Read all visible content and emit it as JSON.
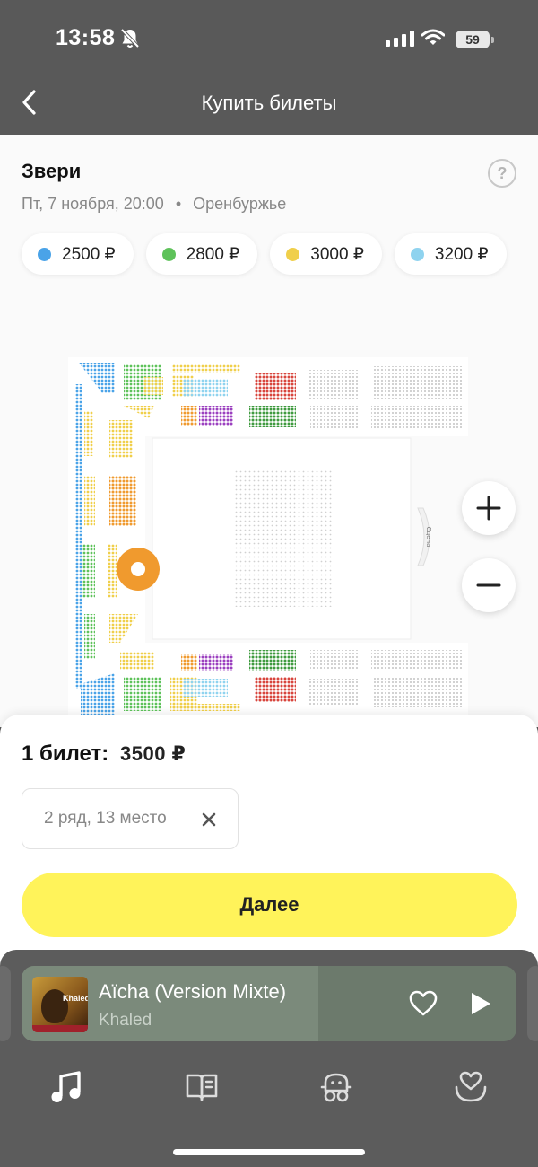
{
  "status_bar": {
    "time": "13:58",
    "battery": "59"
  },
  "nav": {
    "title": "Купить билеты"
  },
  "event": {
    "title": "Звери",
    "date": "Пт, 7 ноября, 20:00",
    "separator": "•",
    "venue": "Оренбуржье",
    "help_label": "?"
  },
  "prices": [
    {
      "label": "2500 ₽",
      "color": "#4aa3e8"
    },
    {
      "label": "2800 ₽",
      "color": "#5ec25a"
    },
    {
      "label": "3000 ₽",
      "color": "#f0cf4a"
    },
    {
      "label": "3200 ₽",
      "color": "#8fd3ef"
    }
  ],
  "map": {
    "stage_label": "Сцена"
  },
  "zoom": {
    "in_label": "+",
    "out_label": "−"
  },
  "selection": {
    "count_label": "1 билет:",
    "total_price": "3500 ₽",
    "seat": "2 ряд, 13 место"
  },
  "actions": {
    "next_label": "Далее"
  },
  "player": {
    "track": "Aïcha (Version Mixte)",
    "artist": "Khaled",
    "cover_text": "Khaled",
    "progress": 0.6
  },
  "colors": {
    "accent_yellow": "#fff35a",
    "selected_seat": "#f09a2e",
    "red_section": "#d8453c",
    "purple_section": "#9b3fbf",
    "dark_green_section": "#3e9a3e"
  }
}
